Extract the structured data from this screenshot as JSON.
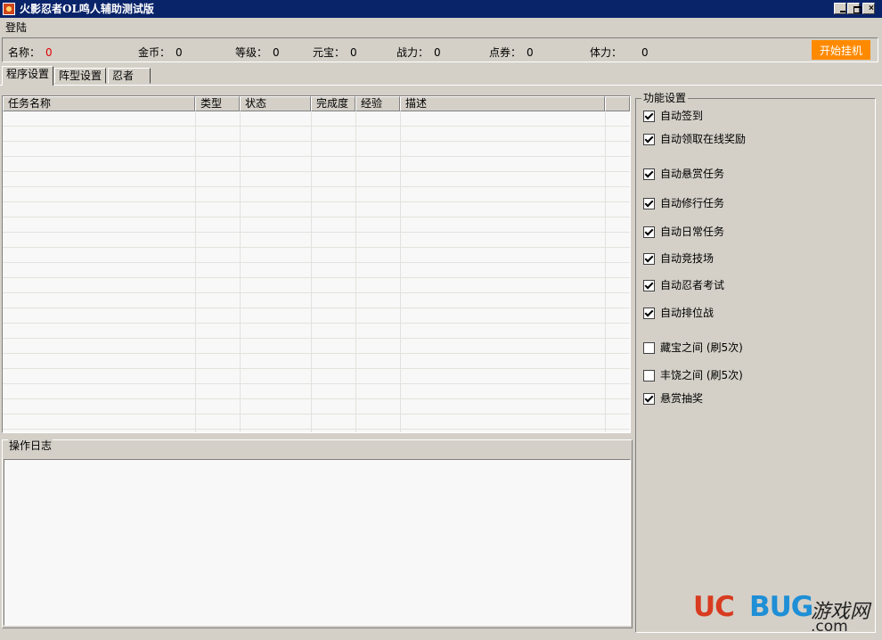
{
  "window": {
    "title": "火影忍者OL鸣人辅助测试版"
  },
  "menu": {
    "login": "登陆"
  },
  "stats": [
    {
      "label": "名称：",
      "value": "0"
    },
    {
      "label": "金币：",
      "value": "0"
    },
    {
      "label": "等级：",
      "value": "0"
    },
    {
      "label": "元宝：",
      "value": "0"
    },
    {
      "label": "战力：",
      "value": "0"
    },
    {
      "label": "点券：",
      "value": "0"
    },
    {
      "label": "体力：",
      "value": "0"
    }
  ],
  "start_button": "开始挂机",
  "tabs": [
    "程序设置",
    "阵型设置",
    "忍者"
  ],
  "task_table": {
    "columns": [
      "任务名称",
      "类型",
      "状态",
      "完成度",
      "经验",
      "描述"
    ],
    "rows": []
  },
  "log": {
    "title": "操作日志",
    "content": ""
  },
  "features": {
    "title": "功能设置",
    "items": [
      {
        "label": "自动签到",
        "checked": true
      },
      {
        "label": "自动领取在线奖励",
        "checked": true
      },
      {
        "label": "自动悬赏任务",
        "checked": true
      },
      {
        "label": "自动修行任务",
        "checked": true
      },
      {
        "label": "自动日常任务",
        "checked": true
      },
      {
        "label": "自动竞技场",
        "checked": true
      },
      {
        "label": "自动忍者考试",
        "checked": true
      },
      {
        "label": "自动排位战",
        "checked": true
      },
      {
        "label": "藏宝之间 (刷5次)",
        "checked": false
      },
      {
        "label": "丰饶之间 (刷5次)",
        "checked": false
      },
      {
        "label": "悬赏抽奖",
        "checked": true
      }
    ]
  },
  "watermark": {
    "uc": "UC",
    "bug": "BUG",
    "cn": "游戏网",
    "com": ".com"
  }
}
